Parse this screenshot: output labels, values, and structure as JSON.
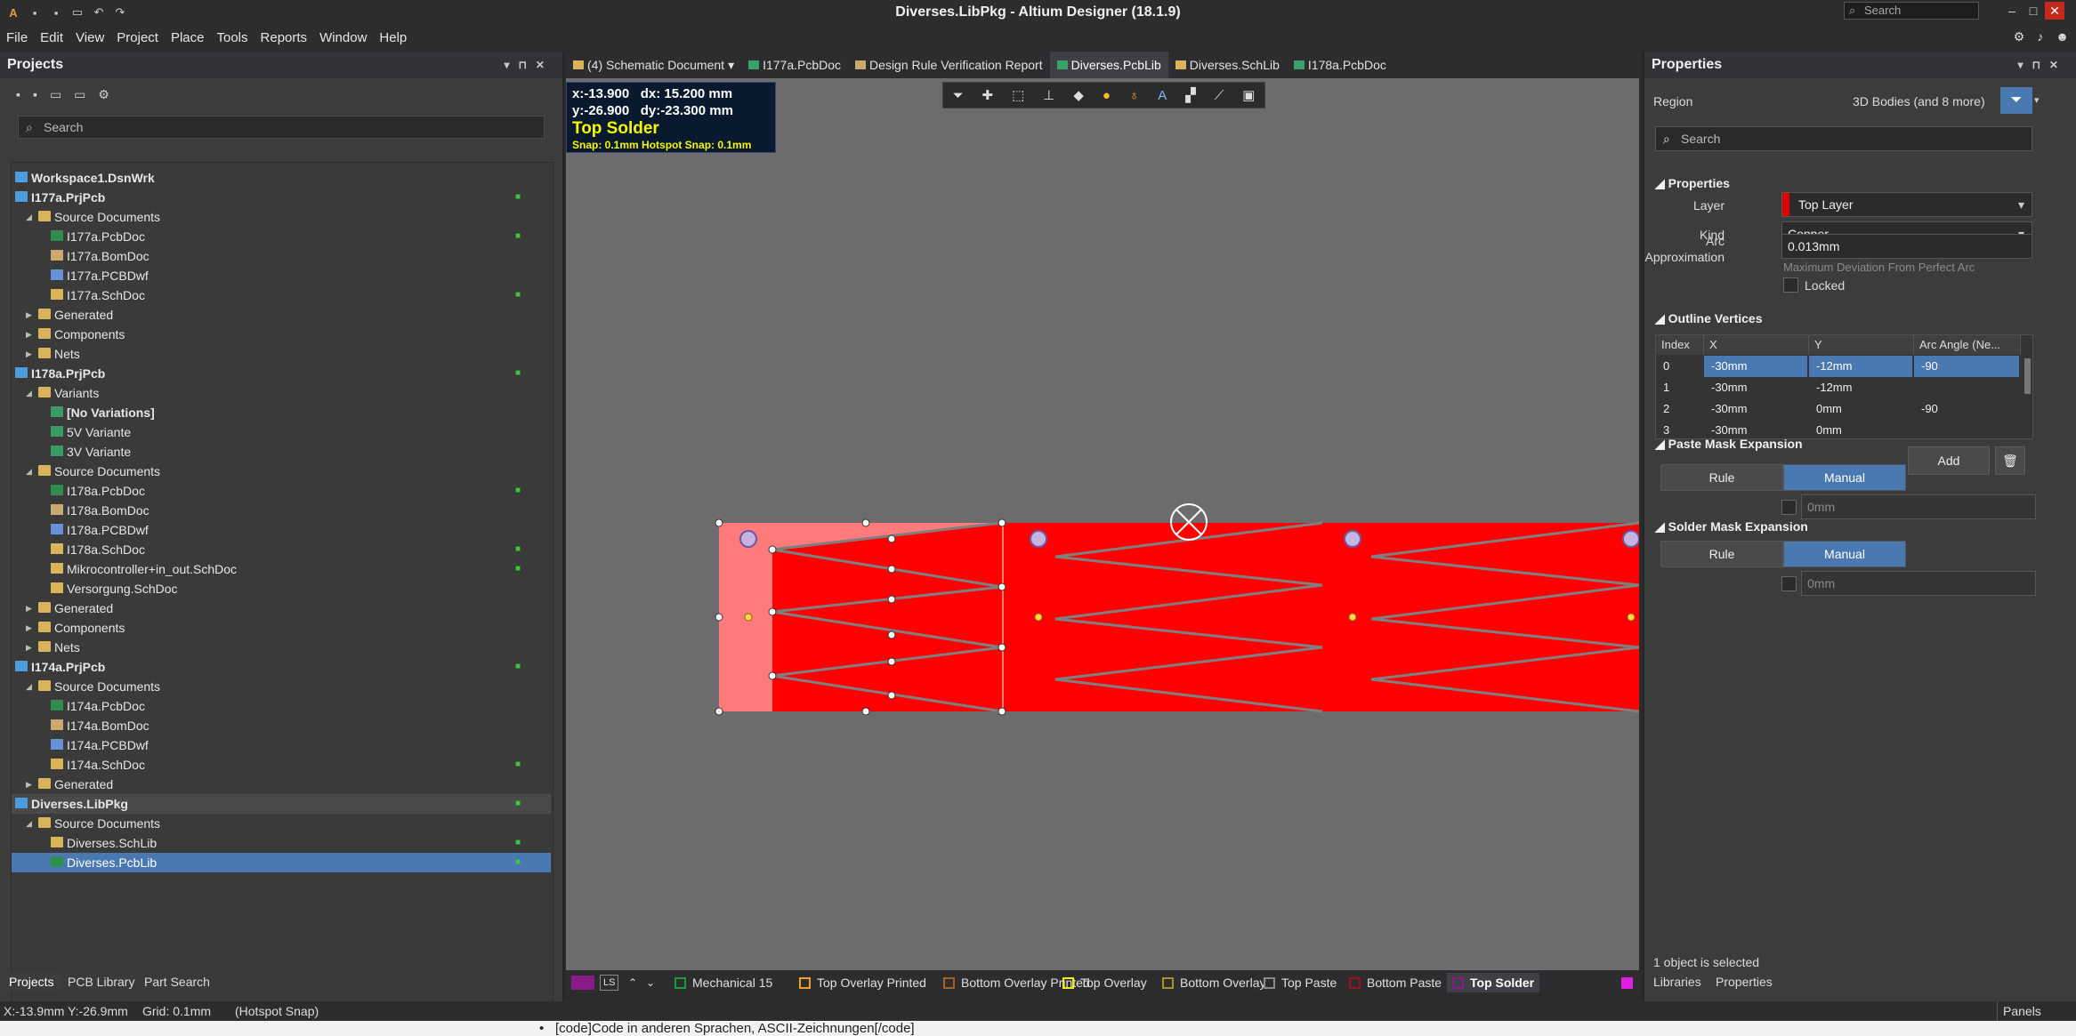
{
  "app": {
    "title": "Diverses.LibPkg - Altium Designer (18.1.9)",
    "search_placeholder": "Search"
  },
  "menu": [
    "File",
    "Edit",
    "View",
    "Project",
    "Place",
    "Tools",
    "Reports",
    "Window",
    "Help"
  ],
  "projects_panel": {
    "title": "Projects",
    "search_placeholder": "Search",
    "tree": [
      {
        "label": "Workspace1.DsnWrk",
        "level": 0,
        "icon": "prj",
        "bold": true,
        "arrow": "",
        "lock": false
      },
      {
        "label": "I177a.PrjPcb",
        "level": 0,
        "icon": "prj",
        "bold": true,
        "arrow": "open",
        "lock": true
      },
      {
        "label": "Source Documents",
        "level": 1,
        "icon": "fold",
        "arrow": "open",
        "lock": false
      },
      {
        "label": "I177a.PcbDoc",
        "level": 2,
        "icon": "pcb",
        "arrow": "",
        "lock": true
      },
      {
        "label": "I177a.BomDoc",
        "level": 2,
        "icon": "bom",
        "arrow": "",
        "lock": false
      },
      {
        "label": "I177a.PCBDwf",
        "level": 2,
        "icon": "dwf",
        "arrow": "",
        "lock": false
      },
      {
        "label": "I177a.SchDoc",
        "level": 2,
        "icon": "sch",
        "arrow": "",
        "lock": true
      },
      {
        "label": "Generated",
        "level": 1,
        "icon": "fold",
        "arrow": "closed",
        "lock": false
      },
      {
        "label": "Components",
        "level": 1,
        "icon": "fold",
        "arrow": "closed",
        "lock": false
      },
      {
        "label": "Nets",
        "level": 1,
        "icon": "fold",
        "arrow": "closed",
        "lock": false
      },
      {
        "label": "I178a.PrjPcb",
        "level": 0,
        "icon": "prj",
        "bold": true,
        "arrow": "open",
        "lock": true
      },
      {
        "label": "Variants",
        "level": 1,
        "icon": "fold",
        "arrow": "open",
        "lock": false
      },
      {
        "label": "[No Variations]",
        "level": 2,
        "icon": "var",
        "bold": true,
        "arrow": "",
        "lock": false
      },
      {
        "label": "5V Variante",
        "level": 2,
        "icon": "var",
        "arrow": "",
        "lock": false
      },
      {
        "label": "3V Variante",
        "level": 2,
        "icon": "var",
        "arrow": "",
        "lock": false
      },
      {
        "label": "Source Documents",
        "level": 1,
        "icon": "fold",
        "arrow": "open",
        "lock": false
      },
      {
        "label": "I178a.PcbDoc",
        "level": 2,
        "icon": "pcb",
        "arrow": "",
        "lock": true
      },
      {
        "label": "I178a.BomDoc",
        "level": 2,
        "icon": "bom",
        "arrow": "",
        "lock": false
      },
      {
        "label": "I178a.PCBDwf",
        "level": 2,
        "icon": "dwf",
        "arrow": "",
        "lock": false
      },
      {
        "label": "I178a.SchDoc",
        "level": 2,
        "icon": "sch",
        "arrow": "",
        "lock": true
      },
      {
        "label": "Mikrocontroller+in_out.SchDoc",
        "level": 2,
        "icon": "sch",
        "arrow": "",
        "lock": true
      },
      {
        "label": "Versorgung.SchDoc",
        "level": 2,
        "icon": "sch",
        "arrow": "",
        "lock": false
      },
      {
        "label": "Generated",
        "level": 1,
        "icon": "fold",
        "arrow": "closed",
        "lock": false
      },
      {
        "label": "Components",
        "level": 1,
        "icon": "fold",
        "arrow": "closed",
        "lock": false
      },
      {
        "label": "Nets",
        "level": 1,
        "icon": "fold",
        "arrow": "closed",
        "lock": false
      },
      {
        "label": "I174a.PrjPcb",
        "level": 0,
        "icon": "prj",
        "bold": true,
        "arrow": "open",
        "lock": true
      },
      {
        "label": "Source Documents",
        "level": 1,
        "icon": "fold",
        "arrow": "open",
        "lock": false
      },
      {
        "label": "I174a.PcbDoc",
        "level": 2,
        "icon": "pcb",
        "arrow": "",
        "lock": false
      },
      {
        "label": "I174a.BomDoc",
        "level": 2,
        "icon": "bom",
        "arrow": "",
        "lock": false
      },
      {
        "label": "I174a.PCBDwf",
        "level": 2,
        "icon": "dwf",
        "arrow": "",
        "lock": false
      },
      {
        "label": "I174a.SchDoc",
        "level": 2,
        "icon": "sch",
        "arrow": "",
        "lock": true
      },
      {
        "label": "Generated",
        "level": 1,
        "icon": "fold",
        "arrow": "closed",
        "lock": false
      },
      {
        "label": "Diverses.LibPkg",
        "level": 0,
        "icon": "prj",
        "bold": true,
        "arrow": "open",
        "lock": true,
        "hl": true
      },
      {
        "label": "Source Documents",
        "level": 1,
        "icon": "fold",
        "arrow": "open",
        "lock": false
      },
      {
        "label": "Diverses.SchLib",
        "level": 2,
        "icon": "sch",
        "arrow": "",
        "lock": true
      },
      {
        "label": "Diverses.PcbLib",
        "level": 2,
        "icon": "pcb",
        "arrow": "",
        "lock": true,
        "sel": true
      }
    ],
    "bottom_tabs": [
      "Projects",
      "PCB Library",
      "Part Search"
    ]
  },
  "doc_tabs": [
    {
      "label": "(4) Schematic Document",
      "icon": "sch",
      "dropdown": true
    },
    {
      "label": "I177a.PcbDoc",
      "icon": "pcb"
    },
    {
      "label": "Design Rule Verification Report",
      "icon": "bom"
    },
    {
      "label": "Diverses.PcbLib",
      "icon": "pcb",
      "active": true
    },
    {
      "label": "Diverses.SchLib",
      "icon": "sch"
    },
    {
      "label": "I178a.PcbDoc",
      "icon": "pcb"
    }
  ],
  "hud": {
    "line1": "x:-13.900   dx: 15.200 mm",
    "line2": "y:-26.900   dy:-23.300 mm",
    "layer": "Top Solder",
    "snap": "Snap: 0.1mm Hotspot Snap: 0.1mm"
  },
  "layer_tabs": [
    {
      "label": "Mechanical 15",
      "color": "#1a9a3a"
    },
    {
      "label": "Top Overlay Printed",
      "color": "#f0a020"
    },
    {
      "label": "Bottom Overlay Printed",
      "color": "#a0622a"
    },
    {
      "label": "Top Overlay",
      "color": "#f0f000"
    },
    {
      "label": "Bottom Overlay",
      "color": "#9a9a20"
    },
    {
      "label": "Top Paste",
      "color": "#8a8a8a"
    },
    {
      "label": "Bottom Paste",
      "color": "#9a1020"
    },
    {
      "label": "Top Solder",
      "color": "#8a1a8a",
      "current": true
    }
  ],
  "layer_controls": {
    "ls": "LS"
  },
  "properties": {
    "title": "Properties",
    "region_label": "Region",
    "filter_text": "3D Bodies (and 8 more)",
    "search_placeholder": "Search",
    "section_properties": "Properties",
    "layer_label": "Layer",
    "layer_value": "Top Layer",
    "layer_color": "#e00000",
    "kind_label": "Kind",
    "kind_value": "Copper",
    "arc_label1": "Arc",
    "arc_label2": "Approximation",
    "arc_value": "0.013mm",
    "arc_hint": "Maximum Deviation From Perfect Arc",
    "locked_label": "Locked",
    "section_outline": "Outline Vertices",
    "vertex_headers": [
      "Index",
      "X",
      "Y",
      "Arc Angle (Ne..."
    ],
    "vertices": [
      {
        "i": "0",
        "x": "-30mm",
        "y": "-12mm",
        "a": "-90"
      },
      {
        "i": "1",
        "x": "-30mm",
        "y": "-12mm",
        "a": ""
      },
      {
        "i": "2",
        "x": "-30mm",
        "y": "0mm",
        "a": "-90"
      },
      {
        "i": "3",
        "x": "-30mm",
        "y": "0mm",
        "a": ""
      }
    ],
    "add_label": "Add",
    "section_paste": "Paste Mask Expansion",
    "section_solder": "Solder Mask Expansion",
    "rule_label": "Rule",
    "manual_label": "Manual",
    "paste_value": "0mm",
    "solder_value": "0mm",
    "selection_status": "1 object is selected",
    "bottom_tabs": [
      "Libraries",
      "Properties"
    ]
  },
  "status": {
    "coords": "X:-13.9mm Y:-26.9mm",
    "grid": "Grid: 0.1mm",
    "snap": "(Hotspot Snap)",
    "panels": "Panels"
  },
  "below_text": "[code]Code in anderen Sprachen, ASCII-Zeichnungen[/code]"
}
